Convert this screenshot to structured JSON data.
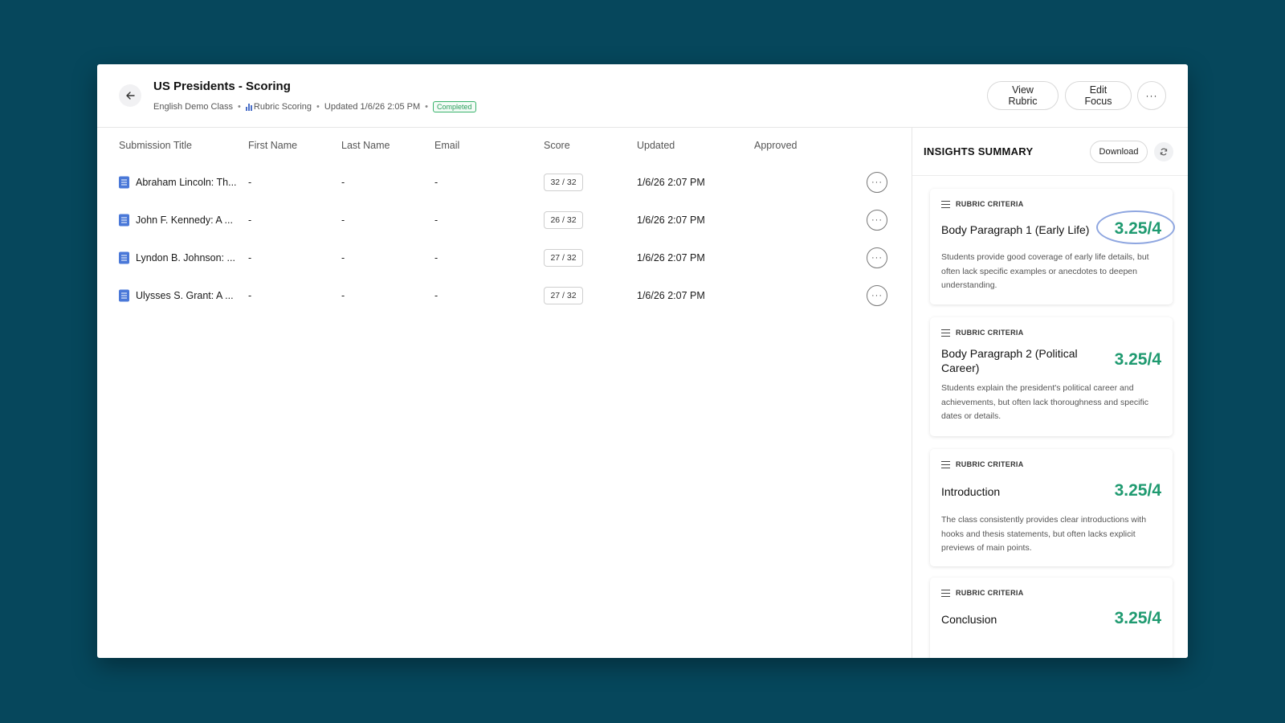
{
  "header": {
    "title": "US Presidents - Scoring",
    "class_name": "English Demo Class",
    "scoring_type": "Rubric Scoring",
    "updated": "Updated 1/6/26 2:05 PM",
    "status": "Completed",
    "view_rubric_label": "View Rubric",
    "edit_focus_label": "Edit Focus",
    "more_label": "···"
  },
  "table": {
    "columns": [
      "Submission Title",
      "First Name",
      "Last Name",
      "Email",
      "Score",
      "Updated",
      "Approved"
    ],
    "rows": [
      {
        "title": "Abraham Lincoln: Th...",
        "first": "-",
        "last": "-",
        "email": "-",
        "score": "32 / 32",
        "updated": "1/6/26 2:07 PM",
        "approved": ""
      },
      {
        "title": "John F. Kennedy: A ...",
        "first": "-",
        "last": "-",
        "email": "-",
        "score": "26 / 32",
        "updated": "1/6/26 2:07 PM",
        "approved": ""
      },
      {
        "title": "Lyndon B. Johnson: ...",
        "first": "-",
        "last": "-",
        "email": "-",
        "score": "27 / 32",
        "updated": "1/6/26 2:07 PM",
        "approved": ""
      },
      {
        "title": "Ulysses S. Grant: A ...",
        "first": "-",
        "last": "-",
        "email": "-",
        "score": "27 / 32",
        "updated": "1/6/26 2:07 PM",
        "approved": ""
      }
    ],
    "row_more_label": "···"
  },
  "insights": {
    "title": "INSIGHTS SUMMARY",
    "download_label": "Download",
    "cards": [
      {
        "label": "RUBRIC CRITERIA",
        "name": "Body Paragraph 1 (Early Life)",
        "score": "3.25/4",
        "description": "Students provide good coverage of early life details, but often lack specific examples or anecdotes to deepen understanding."
      },
      {
        "label": "RUBRIC CRITERIA",
        "name": "Body Paragraph 2 (Political Career)",
        "score": "3.25/4",
        "description": "Students explain the president's political career and achievements, but often lack thoroughness and specific dates or details."
      },
      {
        "label": "RUBRIC CRITERIA",
        "name": "Introduction",
        "score": "3.25/4",
        "description": "The class consistently provides clear introductions with hooks and thesis statements, but often lacks explicit previews of main points."
      },
      {
        "label": "RUBRIC CRITERIA",
        "name": "Conclusion",
        "score": "3.25/4",
        "description": ""
      }
    ]
  },
  "colors": {
    "background": "#06475c",
    "score_green": "#1f9a70",
    "badge_green": "#38b26b",
    "doc_icon_blue": "#4a78d8",
    "annotation_circle": "#8ea6e0"
  }
}
